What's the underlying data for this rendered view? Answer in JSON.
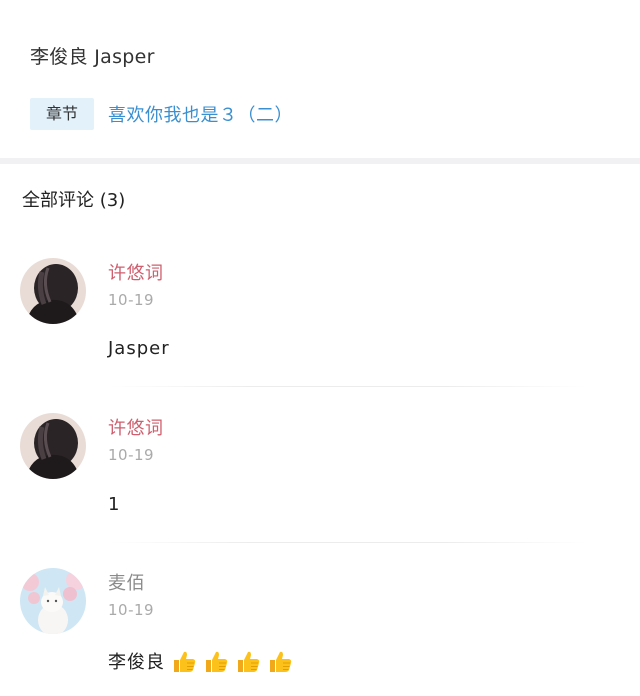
{
  "author": "李俊良 Jasper",
  "chapter": {
    "tag": "章节",
    "title": "喜欢你我也是３（二）"
  },
  "comments_header": "全部评论 (3)",
  "comments": [
    {
      "name": "许悠词",
      "date": "10-19",
      "text": "Jasper",
      "name_color": "#cf5f6e",
      "avatar": "dark-hair-avatar"
    },
    {
      "name": "许悠词",
      "date": "10-19",
      "text": "1",
      "name_color": "#cf5f6e",
      "avatar": "dark-hair-avatar"
    },
    {
      "name": "麦佰",
      "date": "10-19",
      "text": "李俊良",
      "name_color": "#8b8b8b",
      "avatar": "white-cat-blossom-avatar",
      "emoji": [
        "thumbs-up-icon",
        "thumbs-up-icon",
        "thumbs-up-icon",
        "thumbs-up-icon"
      ]
    }
  ]
}
